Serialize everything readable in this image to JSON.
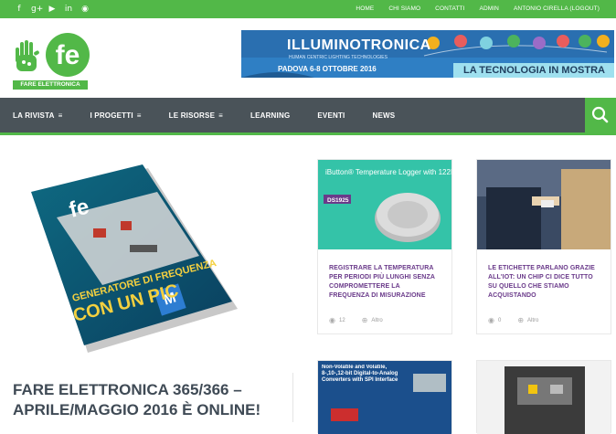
{
  "topbar": {
    "social": [
      {
        "name": "facebook-icon",
        "glyph": "f"
      },
      {
        "name": "google-plus-icon",
        "glyph": "g+"
      },
      {
        "name": "youtube-icon",
        "glyph": "▶"
      },
      {
        "name": "linkedin-icon",
        "glyph": "in"
      },
      {
        "name": "rss-icon",
        "glyph": "◉"
      }
    ],
    "links": [
      "HOME",
      "CHI SIAMO",
      "CONTATTI",
      "ADMIN",
      "ANTONIO CIRELLA (LOGOUT)"
    ]
  },
  "logo": {
    "text": "FARE ELETTRONICA"
  },
  "banner": {
    "title": "ILLUMINOTRONICA",
    "subtitle": "HUMAN CENTRIC LIGHTING TECHNOLOGIES",
    "dates": "PADOVA 6-8 OTTOBRE 2016",
    "tagline": "LA TECNOLOGIA IN MOSTRA"
  },
  "nav": {
    "items": [
      {
        "label": "LA RIVISTA",
        "menu": "≡"
      },
      {
        "label": "I PROGETTI",
        "menu": "≡"
      },
      {
        "label": "LE RISORSE",
        "menu": "≡"
      },
      {
        "label": "LEARNING",
        "menu": ""
      },
      {
        "label": "EVENTI",
        "menu": ""
      },
      {
        "label": "NEWS",
        "menu": ""
      }
    ]
  },
  "feature": {
    "title": "FARE ELETTRONICA 365/366 – APRILE/MAGGIO 2016 È ONLINE!",
    "cover": {
      "brand": "fe",
      "headline1": "GENERATORE DI FREQUENZA",
      "headline2": "CON UN PIC",
      "badge": "M"
    }
  },
  "cards": [
    {
      "title": "REGISTRARE LA TEMPERATURA PER PERIODI PIÙ LUNGHI SENZA COMPROMETTERE LA FREQUENZA DI MISURAZIONE",
      "views": "12",
      "more": "Altro",
      "image_text": "iButton® Temperature Logger with 122KB Memory",
      "image_tag": "DS1925"
    },
    {
      "title": "LE ETICHETTE PARLANO GRAZIE ALL'IOT: UN CHIP CI DICE TUTTO SU QUELLO CHE STIAMO ACQUISTANDO",
      "views": "0",
      "more": "Altro"
    },
    {
      "title": "",
      "image_text": "Non-Volatile and Volatile, 8-,10-,12-bit Digital-to-Analog Converters with SPI Interface"
    },
    {
      "title": ""
    }
  ],
  "colors": {
    "green": "#52b848",
    "nav": "#4a5359",
    "purple": "#6a3a8a"
  }
}
